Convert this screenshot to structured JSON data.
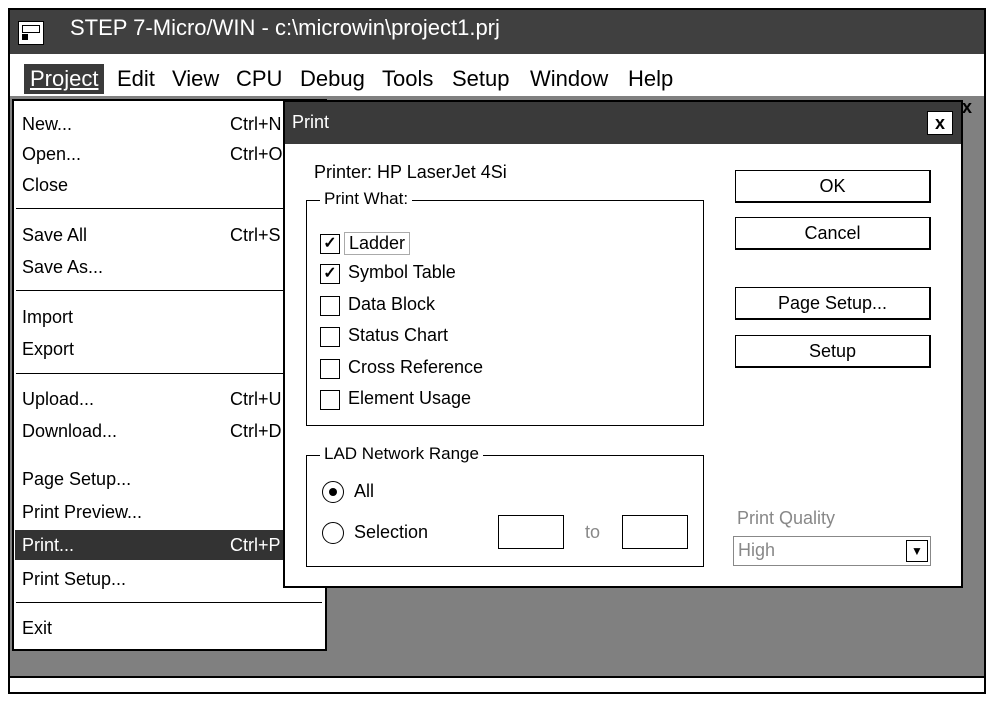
{
  "window": {
    "title": "STEP 7-Micro/WIN - c:\\microwin\\project1.prj"
  },
  "menubar": {
    "items": [
      {
        "label": "Project"
      },
      {
        "label": "Edit"
      },
      {
        "label": "View"
      },
      {
        "label": "CPU"
      },
      {
        "label": "Debug"
      },
      {
        "label": "Tools"
      },
      {
        "label": "Setup"
      },
      {
        "label": "Window"
      },
      {
        "label": "Help"
      }
    ]
  },
  "mdi_close": "x",
  "project_menu": {
    "items": [
      {
        "label": "New...",
        "shortcut": "Ctrl+N"
      },
      {
        "label": "Open...",
        "shortcut": "Ctrl+O"
      },
      {
        "label": "Close",
        "shortcut": ""
      },
      {
        "label": "Save All",
        "shortcut": "Ctrl+S"
      },
      {
        "label": "Save As...",
        "shortcut": ""
      },
      {
        "label": "Import",
        "shortcut": ""
      },
      {
        "label": "Export",
        "shortcut": ""
      },
      {
        "label": "Upload...",
        "shortcut": "Ctrl+U"
      },
      {
        "label": "Download...",
        "shortcut": "Ctrl+D"
      },
      {
        "label": "Page Setup...",
        "shortcut": ""
      },
      {
        "label": "Print Preview...",
        "shortcut": ""
      },
      {
        "label": "Print...",
        "shortcut": "Ctrl+P"
      },
      {
        "label": "Print Setup...",
        "shortcut": ""
      },
      {
        "label": "Exit",
        "shortcut": ""
      }
    ]
  },
  "print_dialog": {
    "title": "Print",
    "close": "x",
    "printer": "Printer: HP LaserJet 4Si",
    "buttons": {
      "ok": "OK",
      "cancel": "Cancel",
      "page_setup": "Page Setup...",
      "setup": "Setup"
    },
    "print_what": {
      "legend": "Print What:",
      "options": [
        {
          "label": "Ladder",
          "checked": true
        },
        {
          "label": "Symbol Table",
          "checked": true
        },
        {
          "label": "Data Block",
          "checked": false
        },
        {
          "label": "Status Chart",
          "checked": false
        },
        {
          "label": "Cross Reference",
          "checked": false
        },
        {
          "label": "Element Usage",
          "checked": false
        }
      ]
    },
    "range": {
      "legend": "LAD Network Range",
      "all": "All",
      "selection": "Selection",
      "to": "to",
      "selected": "all",
      "from_value": "",
      "to_value": ""
    },
    "quality": {
      "label": "Print Quality",
      "value": "High"
    }
  },
  "colors": {
    "titlebar": "#404040",
    "workspace": "#808080",
    "highlight": "#333333"
  }
}
